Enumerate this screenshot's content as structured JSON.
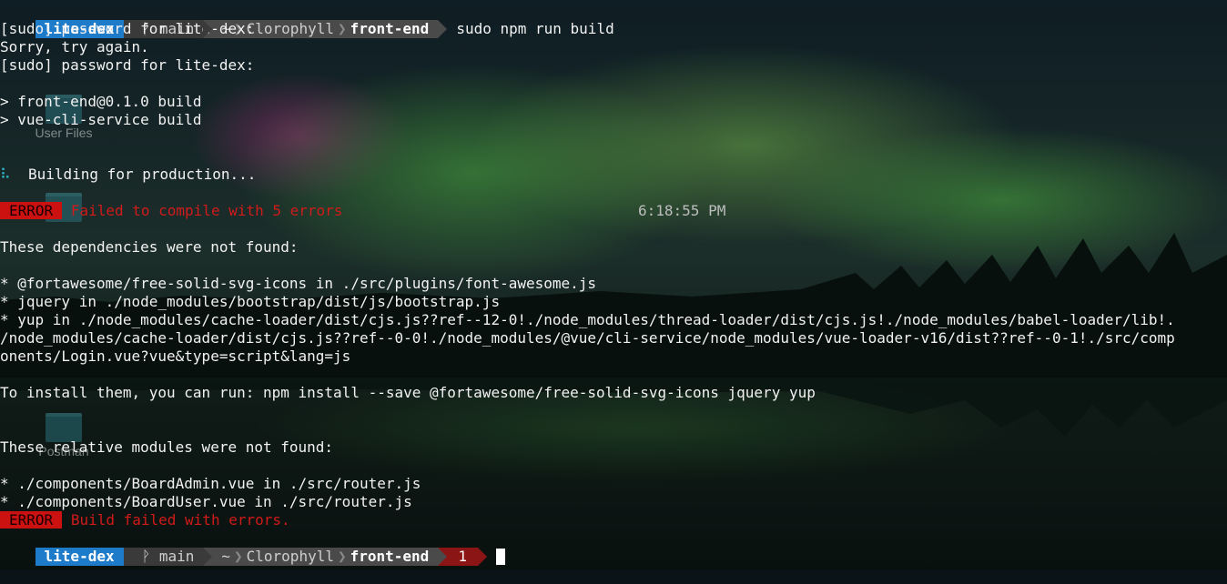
{
  "prompt": {
    "user": "lite-dex",
    "git_branch": "ᚹ main",
    "dir_home": "~",
    "dir_parent": "Clorophyll",
    "dir_current": "front-end",
    "separator": "❯",
    "exit_code": "1"
  },
  "command": "sudo npm run build",
  "output": {
    "sudo_prompt_1": "[sudo] password for lite-dex:",
    "sorry": "Sorry, try again.",
    "sudo_prompt_2": "[sudo] password for lite-dex:",
    "npm_script": "> front-end@0.1.0 build",
    "npm_cmd": "> vue-cli-service build",
    "spinner": "⠧",
    "building": "Building for production...",
    "error_badge": "ERROR",
    "compile_error": "Failed to compile with 5 errors",
    "timestamp": "6:18:55 PM",
    "deps_header": "These dependencies were not found:",
    "deps": [
      "* @fortawesome/free-solid-svg-icons in ./src/plugins/font-awesome.js",
      "* jquery in ./node_modules/bootstrap/dist/js/bootstrap.js",
      "* yup in ./node_modules/cache-loader/dist/cjs.js??ref--12-0!./node_modules/thread-loader/dist/cjs.js!./node_modules/babel-loader/lib!.",
      "/node_modules/cache-loader/dist/cjs.js??ref--0-0!./node_modules/@vue/cli-service/node_modules/vue-loader-v16/dist??ref--0-1!./src/comp",
      "onents/Login.vue?vue&type=script&lang=js"
    ],
    "install_hint": "To install them, you can run: npm install --save @fortawesome/free-solid-svg-icons jquery yup",
    "relative_header": "These relative modules were not found:",
    "relative": [
      "* ./components/BoardAdmin.vue in ./src/router.js",
      "* ./components/BoardUser.vue in ./src/router.js"
    ],
    "build_failed": "Build failed with errors."
  },
  "desktop_icons": [
    {
      "label": "User Files"
    },
    {
      "label": "Postman"
    }
  ],
  "colors": {
    "user_segment": "#1e7bc9",
    "git_segment": "#3a3a3a",
    "dir_segment": "#4a4a4a",
    "exit_segment": "#8b1414",
    "error_badge": "#cc1111",
    "error_text": "#d11a1a",
    "spinner": "#2bb9c9"
  }
}
